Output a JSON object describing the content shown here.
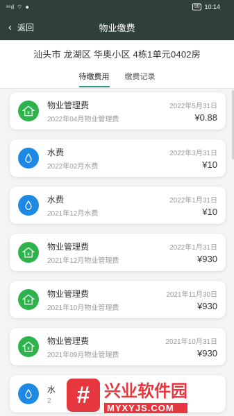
{
  "status_bar": {
    "left": "⁴⁶ıl",
    "battery": "90",
    "time": "10:14"
  },
  "navbar": {
    "back_label": "返回",
    "title": "物业缴费"
  },
  "header": {
    "address": "汕头市 龙湖区 华奥小区 4栋1单元0402房",
    "tabs": [
      {
        "label": "待缴费用",
        "active": true
      },
      {
        "label": "缴费记录",
        "active": false
      }
    ]
  },
  "bills": [
    {
      "type": "property",
      "title": "物业管理费",
      "subtitle": "2022年04月物业管理费",
      "date": "2022年5月31日",
      "amount": "¥0.88",
      "icon": "house-icon",
      "color": "#2eb24c"
    },
    {
      "type": "water",
      "title": "水费",
      "subtitle": "2022年02月水费",
      "date": "2022年3月31日",
      "amount": "¥10",
      "icon": "water-drop-icon",
      "color": "#1e88e5"
    },
    {
      "type": "water",
      "title": "水费",
      "subtitle": "2021年12月水费",
      "date": "2022年1月31日",
      "amount": "¥10",
      "icon": "water-drop-icon",
      "color": "#1e88e5"
    },
    {
      "type": "property",
      "title": "物业管理费",
      "subtitle": "2021年12月物业管理费",
      "date": "2022年1月31日",
      "amount": "¥930",
      "icon": "house-icon",
      "color": "#2eb24c"
    },
    {
      "type": "property",
      "title": "物业管理费",
      "subtitle": "2021年10月物业管理费",
      "date": "2021年11月30日",
      "amount": "¥930",
      "icon": "house-icon",
      "color": "#2eb24c"
    },
    {
      "type": "property",
      "title": "物业管理费",
      "subtitle": "2021年09月物业管理费",
      "date": "2021年10月31日",
      "amount": "¥930",
      "icon": "house-icon",
      "color": "#2eb24c"
    },
    {
      "type": "water",
      "title": "水",
      "subtitle": "2",
      "date": "",
      "amount": "",
      "icon": "water-drop-icon",
      "color": "#1e88e5"
    }
  ],
  "watermark": {
    "text_cn": "兴业软件园",
    "text_en": "MYXYJS.COM"
  }
}
